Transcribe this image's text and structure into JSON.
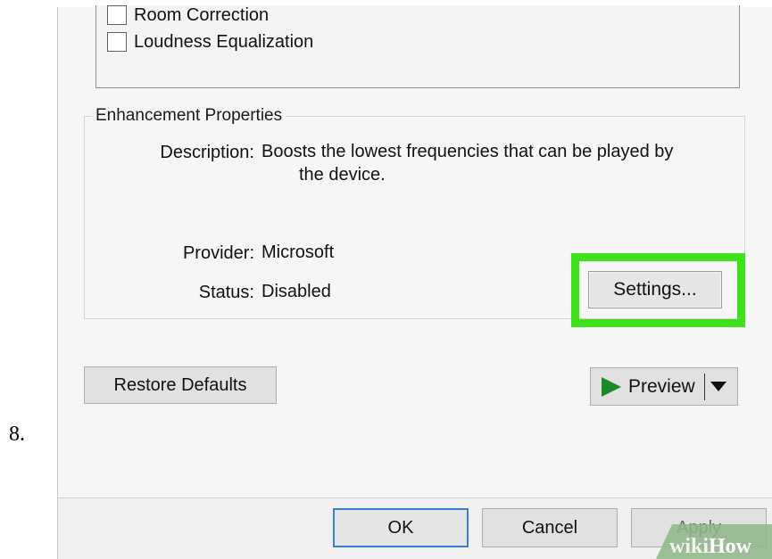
{
  "step_number": "8.",
  "checkboxes": [
    {
      "label": "Room Correction",
      "checked": false
    },
    {
      "label": "Loudness Equalization",
      "checked": false
    }
  ],
  "enhancement": {
    "group_title": "Enhancement Properties",
    "description_label": "Description:",
    "description_line1": "Boosts the lowest frequencies that can be played by",
    "description_line2": "the device.",
    "provider_label": "Provider:",
    "provider_value": "Microsoft",
    "status_label": "Status:",
    "status_value": "Disabled",
    "settings_button": "Settings..."
  },
  "actions": {
    "restore_defaults": "Restore Defaults",
    "preview": "Preview"
  },
  "footer": {
    "ok": "OK",
    "cancel": "Cancel",
    "apply": "Apply"
  },
  "watermark": {
    "part1": "wiki",
    "part2": "How"
  },
  "colors": {
    "highlight": "#3ee11a",
    "play_icon": "#1c8a28"
  }
}
